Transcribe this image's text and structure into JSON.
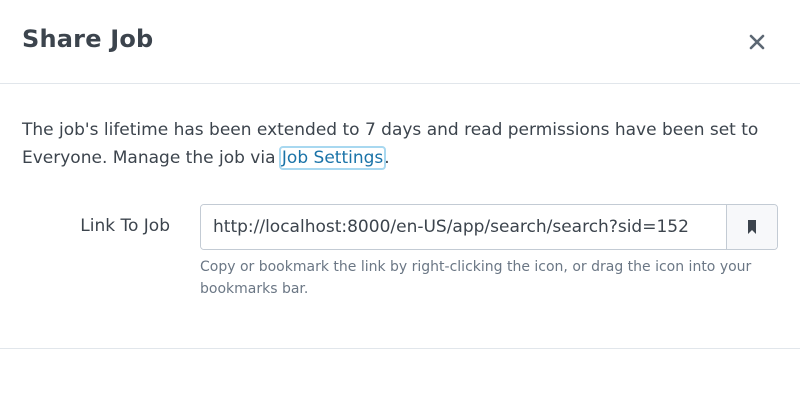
{
  "dialog": {
    "title": "Share Job",
    "close_icon": "close-icon"
  },
  "message": {
    "text_before": "The job's lifetime has been extended to 7 days and read permissions have been set to Everyone. Manage the job via ",
    "link_text": "Job Settings",
    "text_after": "."
  },
  "link_field": {
    "label": "Link To Job",
    "value": "http://localhost:8000/en-US/app/search/search?sid=152",
    "bookmark_icon": "bookmark-icon",
    "help_text": "Copy or bookmark the link by right-clicking the icon, or drag the icon into your bookmarks bar."
  },
  "colors": {
    "link": "#1a73a8",
    "text": "#3c444d",
    "muted": "#6b7785",
    "border": "#c3cbd4",
    "divider": "#e1e6eb"
  }
}
